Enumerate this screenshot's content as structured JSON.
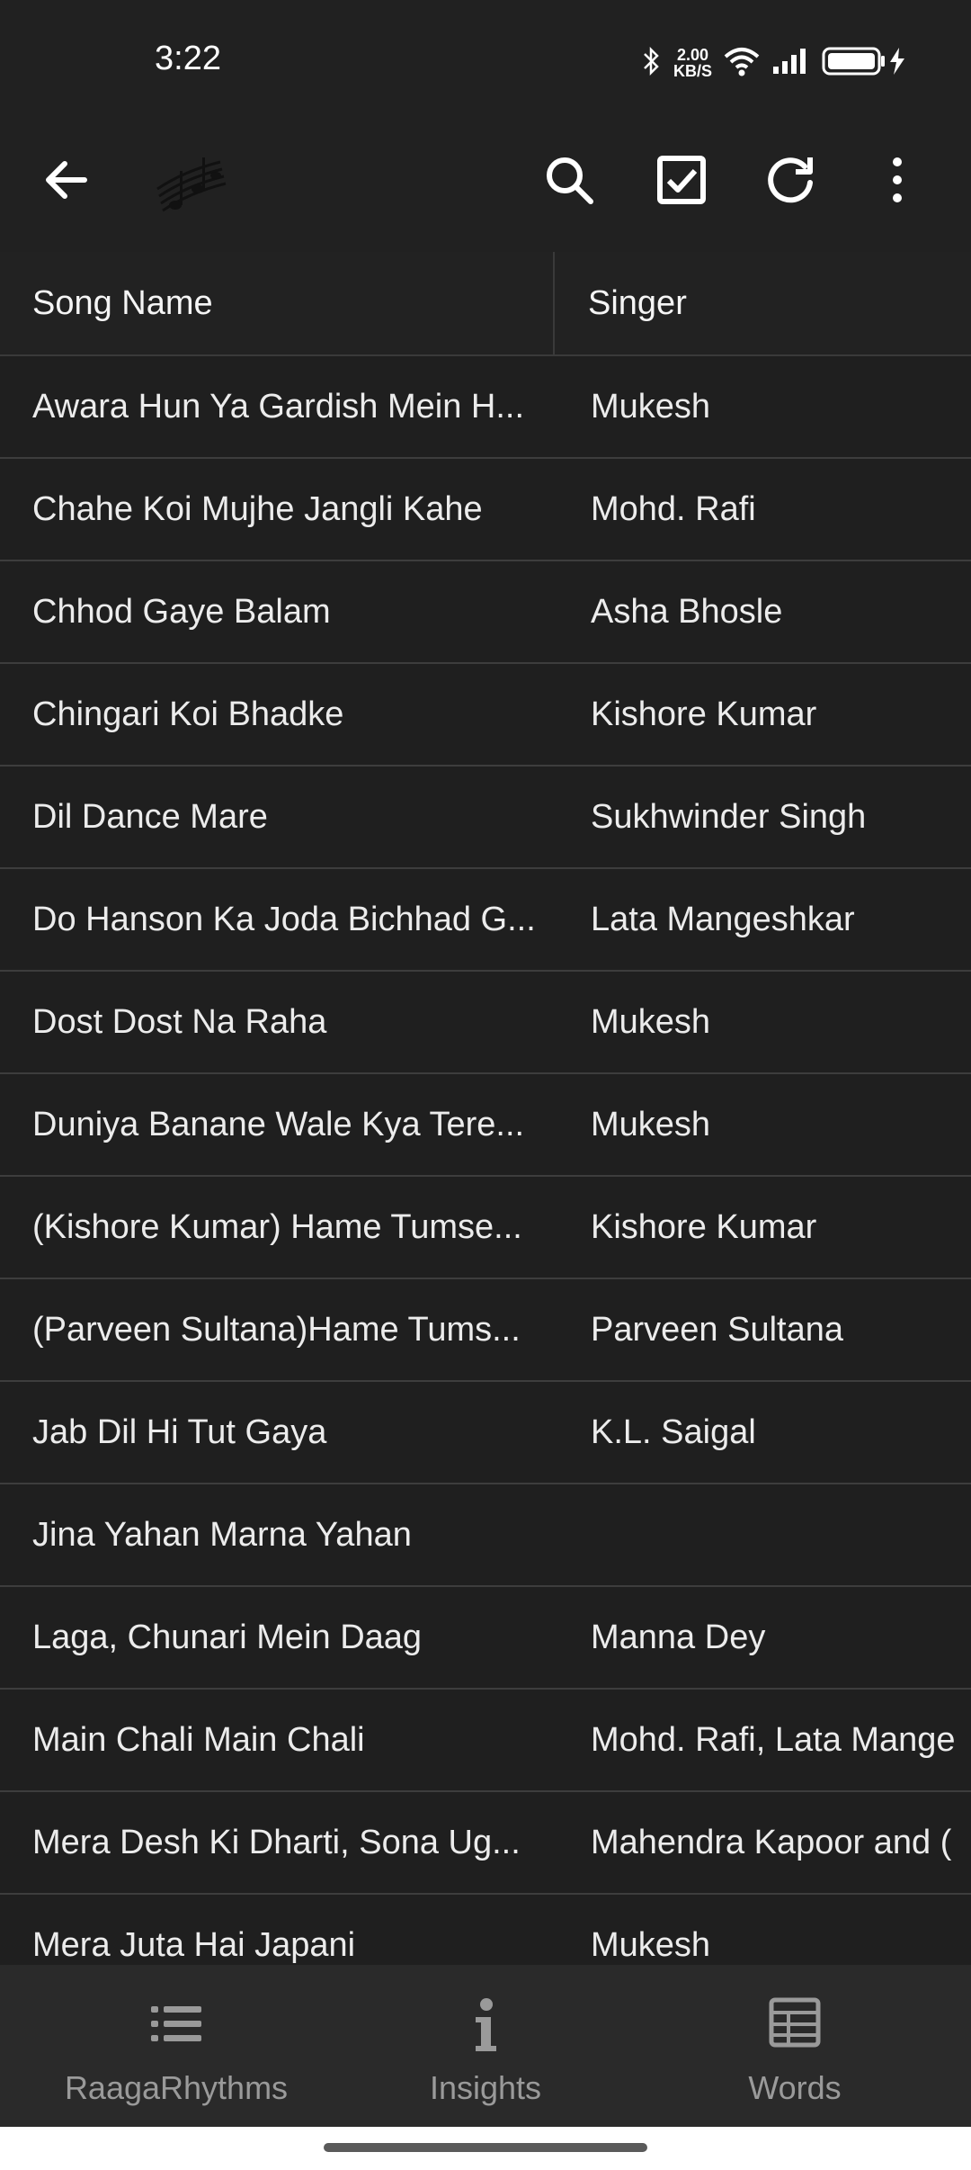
{
  "status": {
    "time": "3:22",
    "net_speed_value": "2.00",
    "net_speed_unit": "KB/S",
    "icons": [
      "bluetooth-icon",
      "wifi-icon",
      "signal-icon",
      "battery-charging-icon"
    ]
  },
  "appbar": {
    "actions": [
      "back-arrow-icon",
      "search-icon",
      "checkbox-icon",
      "refresh-icon",
      "more-vert-icon"
    ]
  },
  "table": {
    "headers": [
      "Song Name",
      "Singer"
    ],
    "rows": [
      {
        "song": "Awara Hun Ya Gardish Mein H...",
        "singer": "Mukesh"
      },
      {
        "song": "Chahe Koi Mujhe Jangli Kahe",
        "singer": "Mohd. Rafi"
      },
      {
        "song": "Chhod Gaye Balam",
        "singer": "Asha Bhosle"
      },
      {
        "song": "Chingari Koi Bhadke",
        "singer": "Kishore Kumar"
      },
      {
        "song": "Dil Dance Mare",
        "singer": "Sukhwinder Singh"
      },
      {
        "song": "Do Hanson Ka Joda Bichhad G...",
        "singer": "Lata Mangeshkar"
      },
      {
        "song": "Dost Dost Na Raha",
        "singer": "Mukesh"
      },
      {
        "song": "Duniya Banane Wale Kya Tere...",
        "singer": "Mukesh"
      },
      {
        "song": "(Kishore Kumar) Hame Tumse...",
        "singer": "Kishore Kumar"
      },
      {
        "song": "(Parveen Sultana)Hame Tums...",
        "singer": "Parveen Sultana"
      },
      {
        "song": "Jab Dil Hi Tut Gaya",
        "singer": "K.L. Saigal"
      },
      {
        "song": "Jina Yahan Marna Yahan",
        "singer": ""
      },
      {
        "song": "Laga, Chunari Mein Daag",
        "singer": "Manna Dey"
      },
      {
        "song": "Main Chali Main Chali",
        "singer": "Mohd. Rafi, Lata Mange"
      },
      {
        "song": "Mera Desh Ki Dharti, Sona Ug...",
        "singer": "Mahendra Kapoor and ("
      },
      {
        "song": "Mera Juta Hai Japani",
        "singer": "Mukesh"
      }
    ]
  },
  "bottom_nav": [
    {
      "label": "RaagaRhythms",
      "icon": "list-icon"
    },
    {
      "label": "Insights",
      "icon": "info-icon"
    },
    {
      "label": "Words",
      "icon": "table-grid-icon"
    }
  ],
  "colors": {
    "background": "#1f1f1f",
    "bar": "#212121",
    "nav": "#2a2a2a",
    "divider": "#3d3d3d",
    "text": "#ececec",
    "muted": "#9a9a9a"
  }
}
